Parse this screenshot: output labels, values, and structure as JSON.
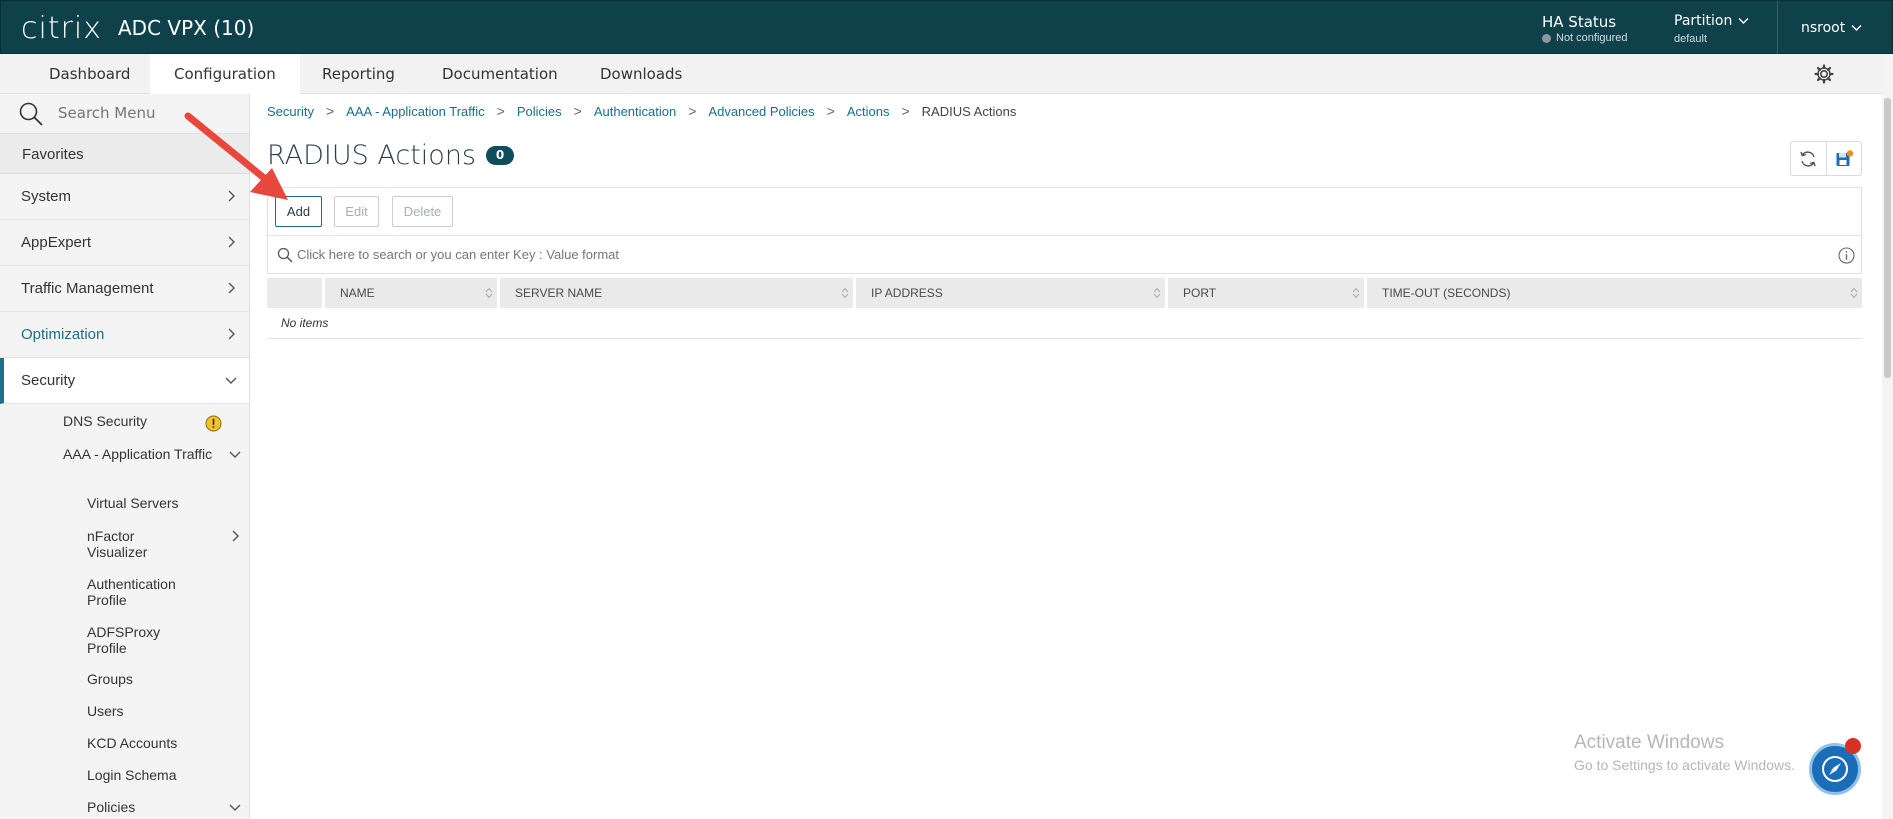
{
  "header": {
    "logo": "citrix",
    "product": "ADC VPX (10)",
    "ha_status_label": "HA Status",
    "ha_status_value": "Not configured",
    "partition_label": "Partition",
    "partition_value": "default",
    "user": "nsroot"
  },
  "nav": {
    "tabs": [
      {
        "label": "Dashboard"
      },
      {
        "label": "Configuration"
      },
      {
        "label": "Reporting"
      },
      {
        "label": "Documentation"
      },
      {
        "label": "Downloads"
      }
    ],
    "active_tab": "Configuration"
  },
  "sidebar": {
    "search_placeholder": "Search Menu",
    "favorites": "Favorites",
    "items": [
      {
        "label": "System"
      },
      {
        "label": "AppExpert"
      },
      {
        "label": "Traffic Management"
      },
      {
        "label": "Optimization"
      },
      {
        "label": "Security"
      }
    ],
    "security_children": [
      {
        "label": "DNS Security"
      },
      {
        "label": "AAA - Application Traffic"
      }
    ],
    "aaa_children": [
      {
        "label": "Virtual Servers"
      },
      {
        "label": "nFactor Visualizer"
      },
      {
        "label": "Authentication Profile"
      },
      {
        "label": "ADFSProxy Profile"
      },
      {
        "label": "Groups"
      },
      {
        "label": "Users"
      },
      {
        "label": "KCD Accounts"
      },
      {
        "label": "Login Schema"
      },
      {
        "label": "Policies"
      }
    ]
  },
  "breadcrumb": [
    "Security",
    "AAA - Application Traffic",
    "Policies",
    "Authentication",
    "Advanced Policies",
    "Actions",
    "RADIUS Actions"
  ],
  "page": {
    "title": "RADIUS Actions",
    "count": "0"
  },
  "toolbar": {
    "add_label": "Add",
    "edit_label": "Edit",
    "delete_label": "Delete"
  },
  "table": {
    "search_placeholder": "Click here to search or you can enter Key : Value format",
    "columns": [
      "NAME",
      "SERVER NAME",
      "IP ADDRESS",
      "PORT",
      "TIME-OUT (SECONDS)"
    ],
    "empty_text": "No items"
  },
  "watermark": {
    "line1": "Activate Windows",
    "line2": "Go to Settings to activate Windows."
  },
  "colors": {
    "header_bg": "#0e4149",
    "accent": "#1b7189",
    "link": "#1a6d8a",
    "arrow": "#e8473c"
  }
}
